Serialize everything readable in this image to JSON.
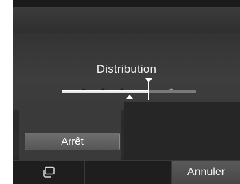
{
  "screen": {
    "title": "Distribution"
  },
  "slider": {
    "level": 0.64
  },
  "buttons": {
    "off_label": "Arrêt"
  },
  "softkeys": {
    "left_icon": "copy-icon",
    "middle_label": "",
    "right_label": "Annuler"
  }
}
